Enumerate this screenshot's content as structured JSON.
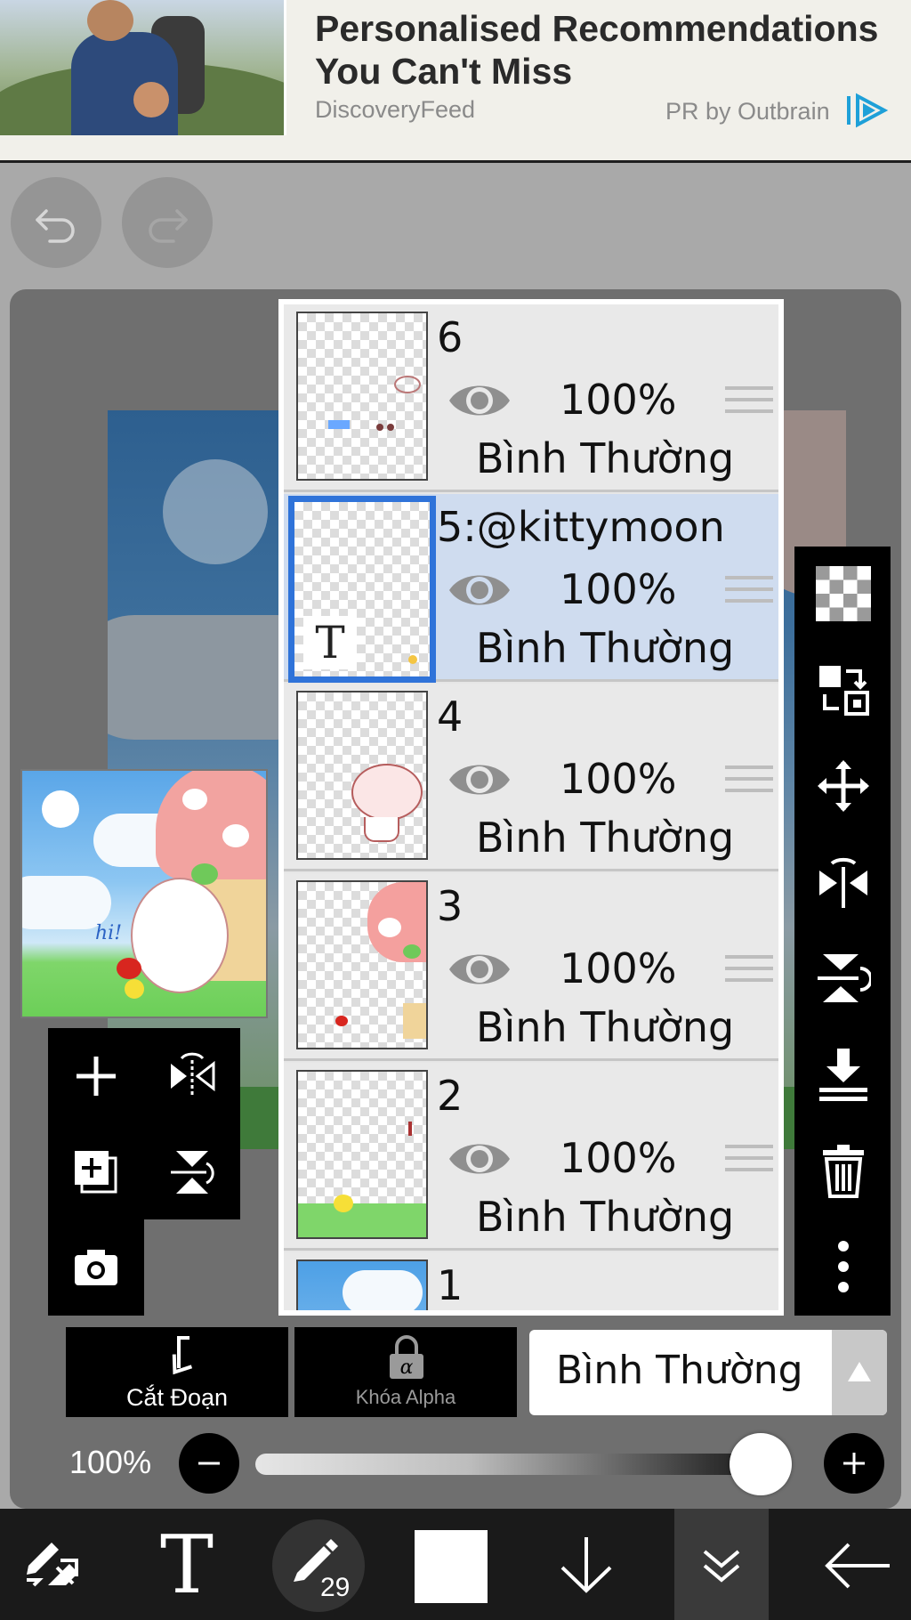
{
  "ad": {
    "title": "Personalised Recommendations You Can't Miss",
    "source": "DiscoveryFeed",
    "sponsor": "PR by Outbrain",
    "logo_icon": "outbrain-logo-icon"
  },
  "history": {
    "undo_icon": "undo-icon",
    "redo_icon": "redo-icon"
  },
  "layers": [
    {
      "name": "6",
      "opacity": "100%",
      "blend": "Bình Thường",
      "selected": false
    },
    {
      "name": "5:@kittymoon",
      "opacity": "100%",
      "blend": "Bình Thường",
      "selected": true,
      "text_badge": "T"
    },
    {
      "name": "4",
      "opacity": "100%",
      "blend": "Bình Thường",
      "selected": false
    },
    {
      "name": "3",
      "opacity": "100%",
      "blend": "Bình Thường",
      "selected": false
    },
    {
      "name": "2",
      "opacity": "100%",
      "blend": "Bình Thường",
      "selected": false
    },
    {
      "name": "1",
      "opacity": "",
      "blend": "",
      "selected": false
    }
  ],
  "left_tools": [
    "add-layer-icon",
    "flip-horizontal-icon",
    "add-copy-icon",
    "flip-vertical-icon",
    "camera-icon"
  ],
  "right_tools": [
    "transparency-icon",
    "swap-icon",
    "move-icon",
    "flip-horizontal-icon",
    "flip-vertical-icon",
    "merge-down-icon",
    "trash-icon",
    "more-icon"
  ],
  "controls": {
    "clip_label": "Cắt Đoạn",
    "alpha_lock_label": "Khóa Alpha",
    "blend_mode": "Bình Thường",
    "opacity_label": "100%",
    "opacity_value": 1.0
  },
  "toolbar": {
    "pen_size": "29",
    "color": "#ffffff",
    "items": [
      "tool-switch-icon",
      "text-tool-icon",
      "pen-icon",
      "color-swatch",
      "arrow-down-icon",
      "layers-icon",
      "back-icon"
    ]
  },
  "colors": {
    "selection": "#2f73d9",
    "selected_row": "#cfdcef",
    "panel_bg": "#000000"
  }
}
